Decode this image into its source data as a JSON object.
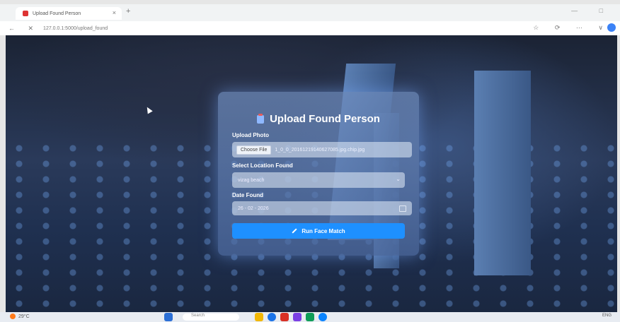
{
  "browser": {
    "tab_title": "Upload Found Person",
    "tab_close": "×",
    "new_tab": "+",
    "window_controls": "— □",
    "nav_buttons": "← ✕",
    "url": "127.0.0.1:5000/upload_found",
    "toolbar_icons": "☆ ⟳ ⋯ ∨"
  },
  "form": {
    "title": "Upload Found Person",
    "upload_label": "Upload Photo",
    "file_button": "Choose File",
    "file_name": "1_0_0_20161219140627085.jpg.chip.jpg",
    "location_label": "Select Location Found",
    "location_value": "vizag beach",
    "location_chevron": "⌄",
    "date_label": "Date Found",
    "date_value": "26 - 02 - 2026",
    "submit_label": "Run Face Match"
  },
  "taskbar": {
    "weather": "29°C",
    "search": "Search",
    "tray": "ENG"
  },
  "colors": {
    "accent": "#1e90ff",
    "card": "#6e8cbe"
  }
}
